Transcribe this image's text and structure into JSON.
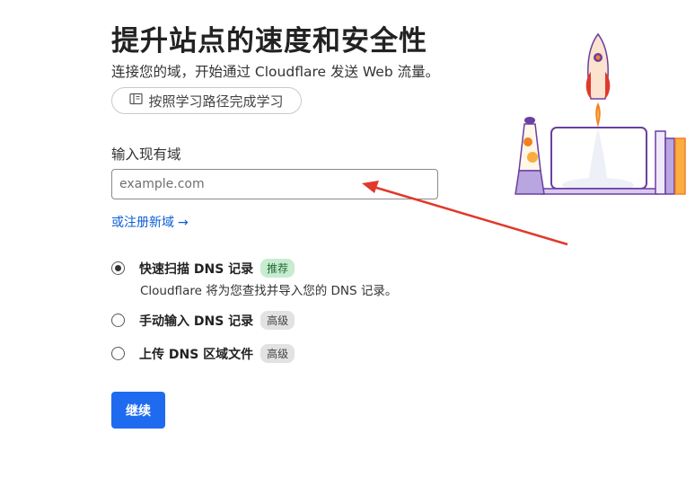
{
  "header": {
    "title": "提升站点的速度和安全性",
    "subtitle": "连接您的域，开始通过 Cloudflare 发送 Web 流量。",
    "learning_path_label": "按照学习路径完成学习",
    "learning_path_icon": "book-icon"
  },
  "domain": {
    "label": "输入现有域",
    "placeholder": "example.com",
    "value": "",
    "register_link": "或注册新域",
    "register_arrow": "→"
  },
  "options": [
    {
      "label": "快速扫描 DNS 记录",
      "badge": "推荐",
      "badge_color": "#c8ecd0",
      "description": "Cloudflare 将为您查找并导入您的 DNS 记录。",
      "selected": true
    },
    {
      "label": "手动输入 DNS 记录",
      "badge": "高级",
      "badge_color": "#e2e2e2",
      "selected": false
    },
    {
      "label": "上传 DNS 区域文件",
      "badge": "高级",
      "badge_color": "#e2e2e2",
      "selected": false
    }
  ],
  "actions": {
    "continue_label": "继续"
  },
  "colors": {
    "primary": "#1f6bf0",
    "link": "#0b5ed7",
    "annotation_arrow": "#e0392b",
    "rocket_orange": "#f38020",
    "illustration_purple": "#6b3fa0"
  }
}
